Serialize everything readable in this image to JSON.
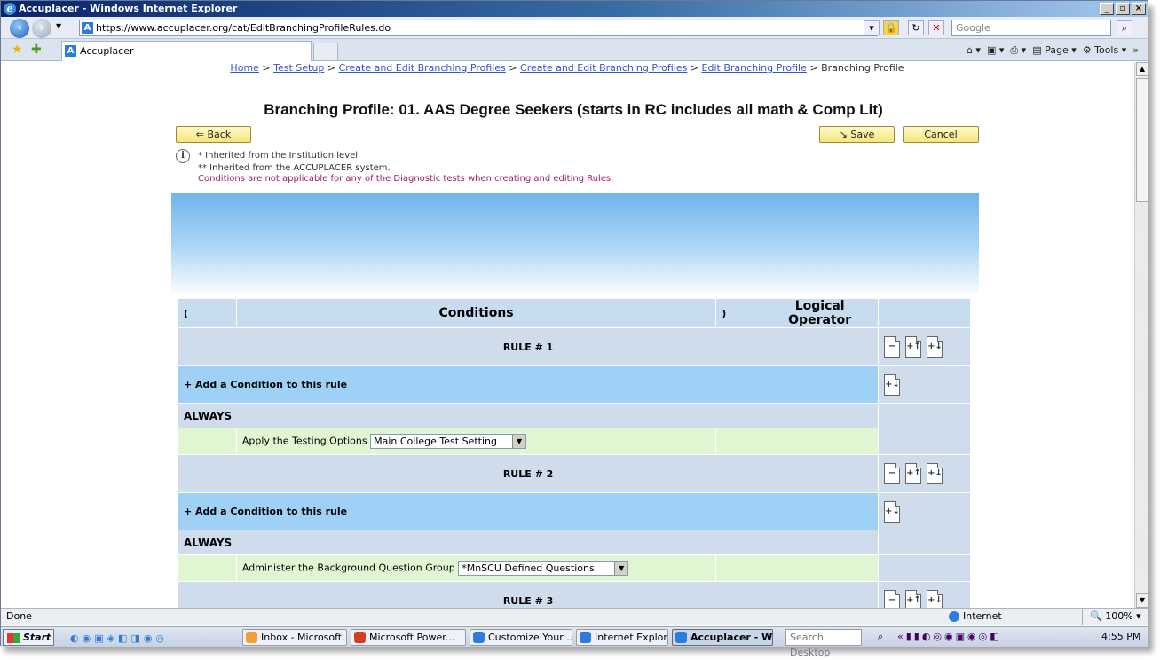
{
  "window": {
    "title": "Accuplacer - Windows Internet Explorer"
  },
  "address": {
    "url": "https://www.accuplacer.org/cat/EditBranchingProfileRules.do",
    "search_placeholder": "Google"
  },
  "tab": {
    "label": "Accuplacer"
  },
  "commandbar": {
    "page": "Page",
    "tools": "Tools"
  },
  "breadcrumb": {
    "home": "Home",
    "test_setup": "Test Setup",
    "cebp1": "Create and Edit Branching Profiles",
    "cebp2": "Create and Edit Branching Profiles",
    "ebp": "Edit Branching Profile",
    "current": "Branching Profile",
    "sep": " > "
  },
  "page": {
    "title": "Branching Profile: 01. AAS Degree Seekers (starts in RC includes all math & Comp Lit)"
  },
  "buttons": {
    "back": "Back",
    "save": "Save",
    "cancel": "Cancel"
  },
  "info": {
    "line1": "* Inherited from the Institution level.",
    "line2": "** Inherited from the ACCUPLACER system.",
    "line3": "Conditions are not applicable for any of the Diagnostic tests when creating and editing Rules."
  },
  "table": {
    "headers": {
      "open_paren": "(",
      "conditions": "Conditions",
      "close_paren": ")",
      "logical_operator": "Logical Operator"
    }
  },
  "rules": [
    {
      "label": "RULE # 1",
      "add_condition": "+ Add a Condition to this rule",
      "always": "ALWAYS",
      "action": "Apply the Testing Options",
      "select_value": "Main College Test Setting"
    },
    {
      "label": "RULE # 2",
      "add_condition": "+ Add a Condition to this rule",
      "always": "ALWAYS",
      "action": "Administer the Background Question Group",
      "select_value": "*MnSCU Defined Questions"
    },
    {
      "label": "RULE # 3"
    }
  ],
  "status": {
    "text": "Done",
    "zone": "Internet",
    "zoom": "100%"
  },
  "taskbar": {
    "start": "Start",
    "tasks": [
      "Inbox - Microsoft...",
      "Microsoft Power...",
      "Customize Your ...",
      "Internet Explore...",
      "Accuplacer - W..."
    ],
    "search": "Search Desktop",
    "time": "4:55 PM"
  }
}
